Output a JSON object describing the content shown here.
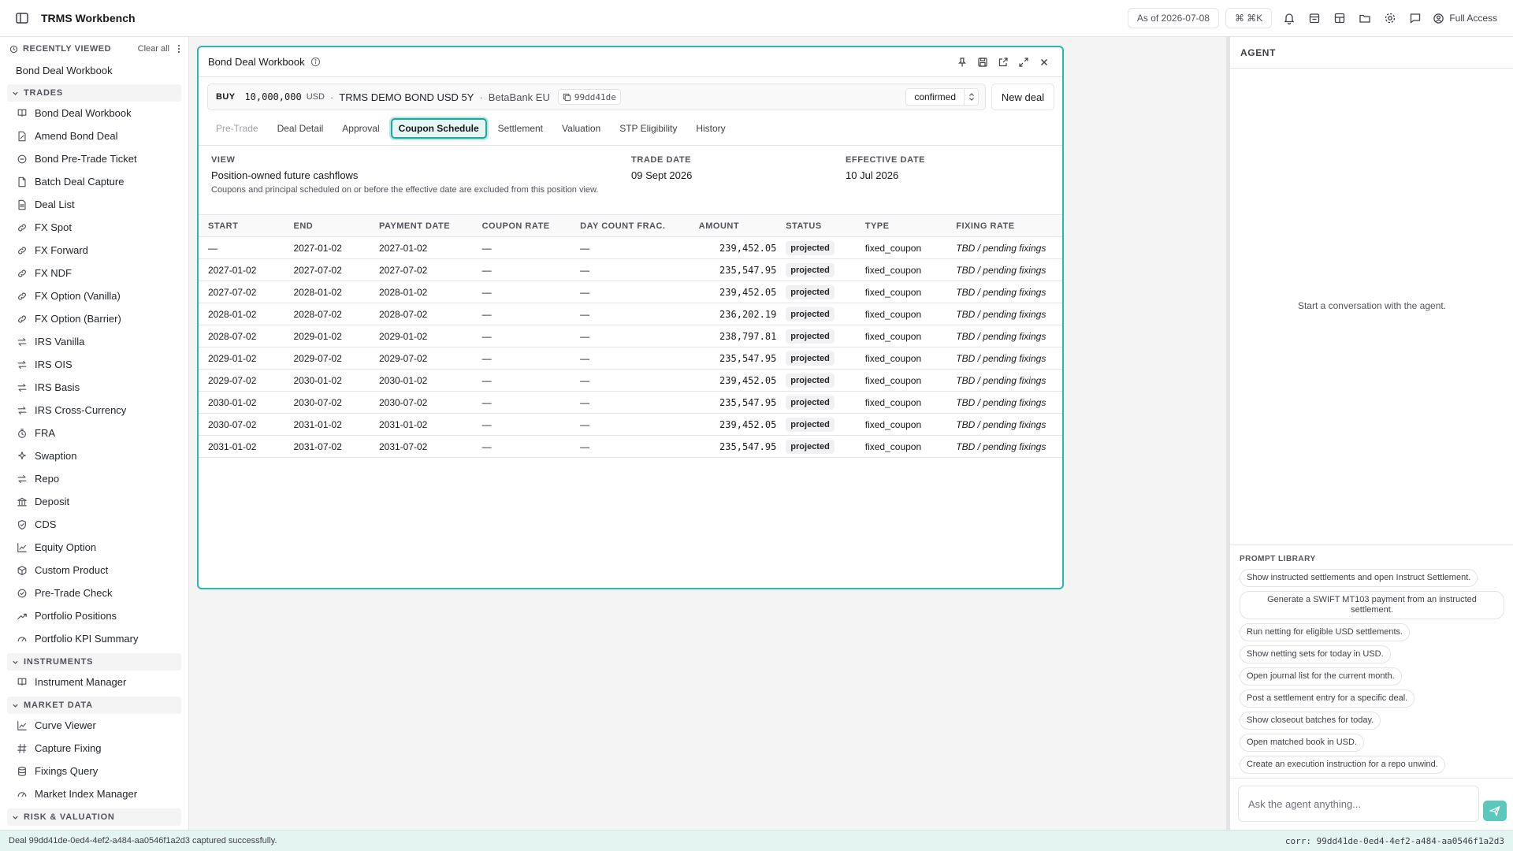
{
  "app": {
    "title": "TRMS Workbench"
  },
  "topbar": {
    "as_of": "As of 2026-07-08",
    "shortcut": "⌘ ⌘K",
    "access": "Full Access"
  },
  "sidebar": {
    "recent_label": "RECENTLY VIEWED",
    "clear_all": "Clear all",
    "recent_items": [
      "Bond Deal Workbook"
    ],
    "sections": [
      {
        "label": "TRADES",
        "items": [
          {
            "label": "Bond Deal Workbook",
            "icon": "book-icon"
          },
          {
            "label": "Amend Bond Deal",
            "icon": "file-edit-icon"
          },
          {
            "label": "Bond Pre-Trade Ticket",
            "icon": "circle-icon"
          },
          {
            "label": "Batch Deal Capture",
            "icon": "file-icon"
          },
          {
            "label": "Deal List",
            "icon": "list-file-icon"
          },
          {
            "label": "FX Spot",
            "icon": "link-icon"
          },
          {
            "label": "FX Forward",
            "icon": "link-icon"
          },
          {
            "label": "FX NDF",
            "icon": "link-icon"
          },
          {
            "label": "FX Option (Vanilla)",
            "icon": "link-icon"
          },
          {
            "label": "FX Option (Barrier)",
            "icon": "link-icon"
          },
          {
            "label": "IRS Vanilla",
            "icon": "swap-icon"
          },
          {
            "label": "IRS OIS",
            "icon": "swap-icon"
          },
          {
            "label": "IRS Basis",
            "icon": "swap-icon"
          },
          {
            "label": "IRS Cross-Currency",
            "icon": "swap-icon"
          },
          {
            "label": "FRA",
            "icon": "timer-icon"
          },
          {
            "label": "Swaption",
            "icon": "sparkle-icon"
          },
          {
            "label": "Repo",
            "icon": "swap-icon"
          },
          {
            "label": "Deposit",
            "icon": "bank-icon"
          },
          {
            "label": "CDS",
            "icon": "shield-icon"
          },
          {
            "label": "Equity Option",
            "icon": "chart-line-icon"
          },
          {
            "label": "Custom Product",
            "icon": "box-icon"
          },
          {
            "label": "Pre-Trade Check",
            "icon": "check-circle-icon"
          },
          {
            "label": "Portfolio Positions",
            "icon": "trend-icon"
          },
          {
            "label": "Portfolio KPI Summary",
            "icon": "gauge-icon"
          }
        ]
      },
      {
        "label": "INSTRUMENTS",
        "items": [
          {
            "label": "Instrument Manager",
            "icon": "book-icon"
          }
        ]
      },
      {
        "label": "MARKET DATA",
        "items": [
          {
            "label": "Curve Viewer",
            "icon": "chart-line-icon"
          },
          {
            "label": "Capture Fixing",
            "icon": "hash-icon"
          },
          {
            "label": "Fixings Query",
            "icon": "database-icon"
          },
          {
            "label": "Market Index Manager",
            "icon": "gauge-icon"
          }
        ]
      },
      {
        "label": "RISK & VALUATION",
        "items": []
      }
    ]
  },
  "workbook": {
    "title": "Bond Deal Workbook",
    "deal": {
      "side": "BUY",
      "amount": "10,000,000",
      "currency": "USD",
      "bond": "TRMS DEMO BOND USD 5Y",
      "counterparty": "BetaBank EU",
      "short_id": "99dd41de",
      "status": "confirmed",
      "dot": "·"
    },
    "new_deal": "New deal",
    "tabs": [
      {
        "label": "Pre-Trade",
        "state": "disabled"
      },
      {
        "label": "Deal Detail",
        "state": "normal"
      },
      {
        "label": "Approval",
        "state": "normal"
      },
      {
        "label": "Coupon Schedule",
        "state": "active"
      },
      {
        "label": "Settlement",
        "state": "normal"
      },
      {
        "label": "Valuation",
        "state": "normal"
      },
      {
        "label": "STP Eligibility",
        "state": "normal"
      },
      {
        "label": "History",
        "state": "normal"
      }
    ],
    "view": {
      "view_label": "VIEW",
      "view_value": "Position-owned future cashflows",
      "view_desc": "Coupons and principal scheduled on or before the effective date are excluded from this position view.",
      "trade_date_label": "TRADE DATE",
      "trade_date": "09 Sept 2026",
      "effective_date_label": "EFFECTIVE DATE",
      "effective_date": "10 Jul 2026"
    },
    "table": {
      "columns": [
        "START",
        "END",
        "PAYMENT DATE",
        "COUPON RATE",
        "DAY COUNT FRAC.",
        "AMOUNT",
        "STATUS",
        "TYPE",
        "FIXING RATE"
      ],
      "rows": [
        [
          "—",
          "2027-01-02",
          "2027-01-02",
          "—",
          "—",
          "239,452.05",
          "projected",
          "fixed_coupon",
          "TBD / pending fixings"
        ],
        [
          "2027-01-02",
          "2027-07-02",
          "2027-07-02",
          "—",
          "—",
          "235,547.95",
          "projected",
          "fixed_coupon",
          "TBD / pending fixings"
        ],
        [
          "2027-07-02",
          "2028-01-02",
          "2028-01-02",
          "—",
          "—",
          "239,452.05",
          "projected",
          "fixed_coupon",
          "TBD / pending fixings"
        ],
        [
          "2028-01-02",
          "2028-07-02",
          "2028-07-02",
          "—",
          "—",
          "236,202.19",
          "projected",
          "fixed_coupon",
          "TBD / pending fixings"
        ],
        [
          "2028-07-02",
          "2029-01-02",
          "2029-01-02",
          "—",
          "—",
          "238,797.81",
          "projected",
          "fixed_coupon",
          "TBD / pending fixings"
        ],
        [
          "2029-01-02",
          "2029-07-02",
          "2029-07-02",
          "—",
          "—",
          "235,547.95",
          "projected",
          "fixed_coupon",
          "TBD / pending fixings"
        ],
        [
          "2029-07-02",
          "2030-01-02",
          "2030-01-02",
          "—",
          "—",
          "239,452.05",
          "projected",
          "fixed_coupon",
          "TBD / pending fixings"
        ],
        [
          "2030-01-02",
          "2030-07-02",
          "2030-07-02",
          "—",
          "—",
          "235,547.95",
          "projected",
          "fixed_coupon",
          "TBD / pending fixings"
        ],
        [
          "2030-07-02",
          "2031-01-02",
          "2031-01-02",
          "—",
          "—",
          "239,452.05",
          "projected",
          "fixed_coupon",
          "TBD / pending fixings"
        ],
        [
          "2031-01-02",
          "2031-07-02",
          "2031-07-02",
          "—",
          "—",
          "235,547.95",
          "projected",
          "fixed_coupon",
          "TBD / pending fixings"
        ]
      ]
    }
  },
  "agent": {
    "title": "AGENT",
    "empty": "Start a conversation with the agent.",
    "prompt_library_label": "PROMPT LIBRARY",
    "prompts": [
      "Show instructed settlements and open Instruct Settlement.",
      "Generate a SWIFT MT103 payment from an instructed settlement.",
      "Run netting for eligible USD settlements.",
      "Show netting sets for today in USD.",
      "Open journal list for the current month.",
      "Post a settlement entry for a specific deal.",
      "Show closeout batches for today.",
      "Open matched book in USD.",
      "Create an execution instruction for a repo unwind."
    ],
    "input_placeholder": "Ask the agent anything..."
  },
  "statusbar": {
    "message": "Deal 99dd41de-0ed4-4ef2-a484-aa0546f1a2d3 captured successfully.",
    "corr": "corr: 99dd41de-0ed4-4ef2-a484-aa0546f1a2d3"
  },
  "colors": {
    "accent": "#2cb7ad",
    "status_bg": "#e3f4f1"
  }
}
